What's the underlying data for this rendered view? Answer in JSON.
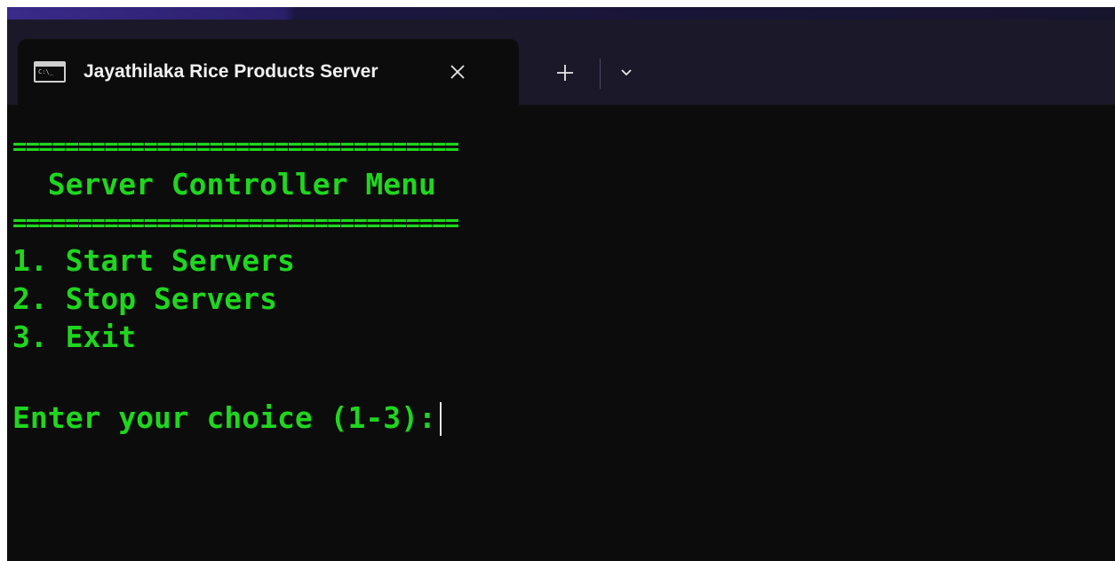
{
  "tab": {
    "title": "Jayathilaka Rice Products Server",
    "icon": "command-prompt-icon",
    "icon_text": "C:\\_"
  },
  "toolbar": {
    "new_tab_icon": "plus-icon",
    "dropdown_icon": "chevron-down-icon",
    "close_icon": "close-icon"
  },
  "console": {
    "separator_top": "==================================",
    "heading": "  Server Controller Menu",
    "separator_bottom": "==================================",
    "menu": [
      "1. Start Servers",
      "2. Stop Servers",
      "3. Exit"
    ],
    "prompt": "Enter your choice (1-3):",
    "input_value": ""
  },
  "colors": {
    "console_text": "#1fd61f",
    "console_bg": "#0c0c0c",
    "tabstrip_bg": "#1b1929"
  }
}
